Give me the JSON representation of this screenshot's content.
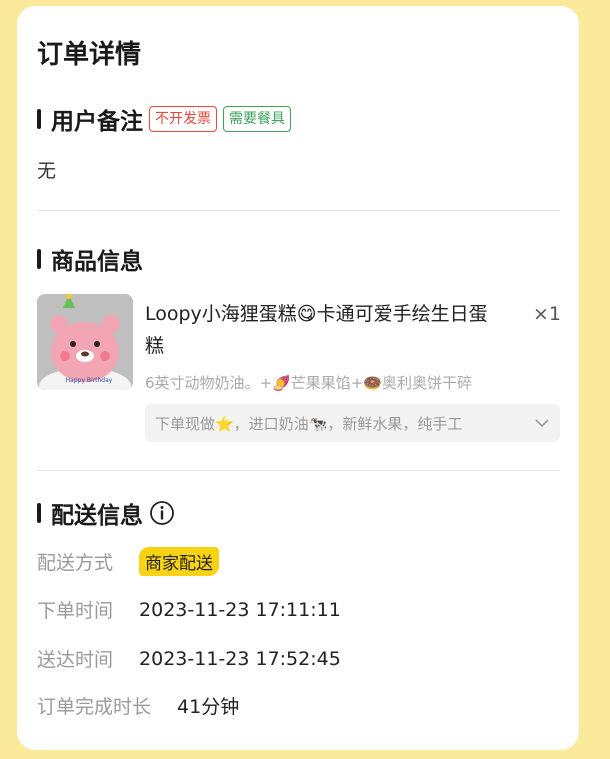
{
  "page_title": "订单详情",
  "remarks_section": {
    "title": "用户备注",
    "tags": [
      "不开发票",
      "需要餐具"
    ],
    "remark": "无"
  },
  "product_section": {
    "title": "商品信息",
    "product": {
      "name": "Loopy小海狸蛋糕😋卡通可爱手绘生日蛋糕",
      "quantity": "×1",
      "spec": "6英寸动物奶油。+🍠芒果果馅+🍩奥利奥饼干碎",
      "description": "下单现做⭐，进口奶油🐄，新鲜水果，纯手工",
      "thumb_caption": "Happy Birthday"
    }
  },
  "delivery_section": {
    "title": "配送信息",
    "rows": [
      {
        "label": "配送方式",
        "value": "商家配送"
      },
      {
        "label": "下单时间",
        "value": "2023-11-23 17:11:11"
      },
      {
        "label": "送达时间",
        "value": "2023-11-23 17:52:45"
      },
      {
        "label": "订单完成时长",
        "value": "41分钟"
      }
    ]
  },
  "colors": {
    "background": "#FBEA9C",
    "badge": "#F8D313",
    "tag_red": "#E8483C",
    "tag_green": "#3DA35D"
  }
}
